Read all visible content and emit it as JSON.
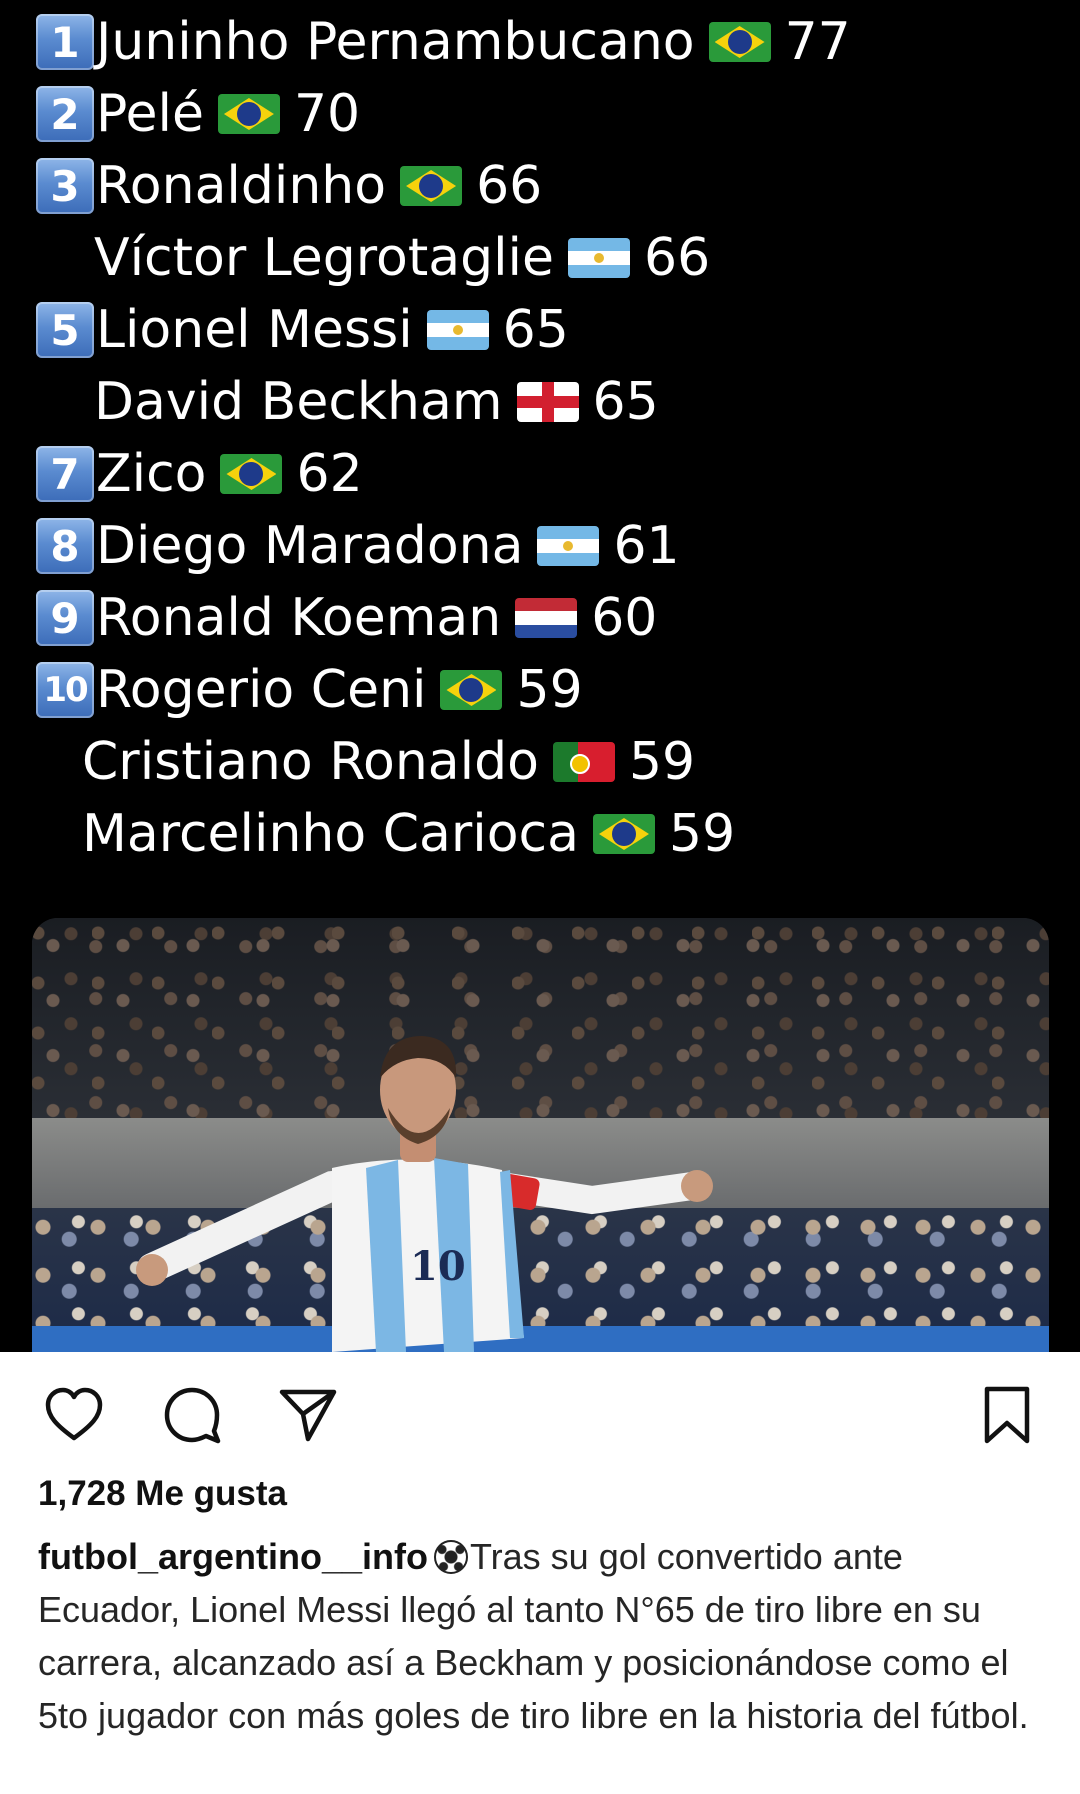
{
  "ranking": [
    {
      "rank": "1",
      "name": "Juninho Pernambucano",
      "flag": "brazil-flag-icon",
      "goals": "77"
    },
    {
      "rank": "2",
      "name": "Pelé",
      "flag": "brazil-flag-icon",
      "goals": "70"
    },
    {
      "rank": "3",
      "name": "Ronaldinho",
      "flag": "brazil-flag-icon",
      "goals": "66"
    },
    {
      "rank": "",
      "name": "Víctor Legrotaglie",
      "flag": "argentina-flag-icon",
      "goals": "66"
    },
    {
      "rank": "5",
      "name": "Lionel Messi",
      "flag": "argentina-flag-icon",
      "goals": "65"
    },
    {
      "rank": "",
      "name": "David Beckham",
      "flag": "england-flag-icon",
      "goals": "65"
    },
    {
      "rank": "7",
      "name": "Zico",
      "flag": "brazil-flag-icon",
      "goals": "62"
    },
    {
      "rank": "8",
      "name": "Diego Maradona",
      "flag": "argentina-flag-icon",
      "goals": "61"
    },
    {
      "rank": "9",
      "name": "Ronald Koeman",
      "flag": "netherlands-flag-icon",
      "goals": "60"
    },
    {
      "rank": "10",
      "name": "Rogerio Ceni",
      "flag": "brazil-flag-icon",
      "goals": "59"
    },
    {
      "rank": "",
      "name": "Cristiano Ronaldo",
      "flag": "portugal-flag-icon",
      "goals": "59"
    },
    {
      "rank": "",
      "name": "Marcelinho Carioca",
      "flag": "brazil-flag-icon",
      "goals": "59"
    }
  ],
  "photo": {
    "jersey_number": "10"
  },
  "actions": {
    "like_icon": "heart-icon",
    "comment_icon": "comment-icon",
    "share_icon": "send-icon",
    "save_icon": "bookmark-icon"
  },
  "post": {
    "likes": "1,728 Me gusta",
    "username": "futbol_argentino__info",
    "emoji": "soccer-ball-icon",
    "caption": "Tras su gol convertido ante Ecuador, Lionel Messi llegó al tanto N°65 de tiro libre en su carrera, alcanzado así a Beckham y posicionándose como el 5to jugador con más goles de tiro libre en la historia del fútbol."
  }
}
